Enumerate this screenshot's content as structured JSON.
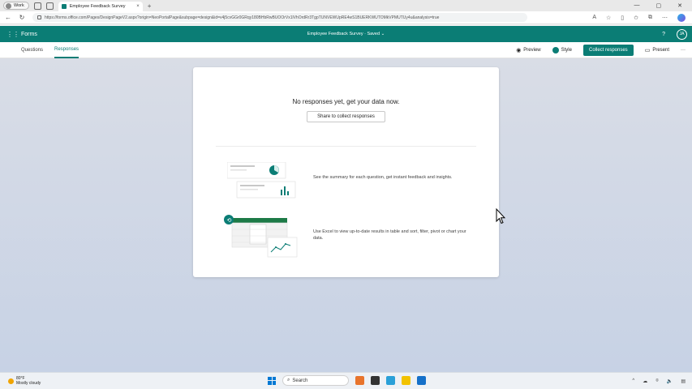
{
  "browser": {
    "profile_label": "Work",
    "tab_title": "Employee Feedback Survey",
    "tab_close": "×",
    "new_tab": "+",
    "url": "https://forms.office.com/Pages/DesignPageV2.aspx?origin=NeoPortalPage&subpage=design&id=v4j5cvGGr0GRqy180BHbRwBUOOrVx1lVhOrdRr3TgpTUNVEWUpRE4wS1BUERKWUTOMkVPMUTUy4u&analysis=true",
    "window_controls": [
      "—",
      "▢",
      "✕"
    ]
  },
  "forms_header": {
    "app_name": "Forms",
    "doc_title": "Employee Feedback Survey · Saved",
    "help_label": "?",
    "avatar_label": "JA"
  },
  "page_tabs": {
    "questions": "Questions",
    "responses": "Responses"
  },
  "toolbar": {
    "preview_label": "Preview",
    "style_label": "Style",
    "collect_label": "Collect responses",
    "present_label": "Present",
    "more_label": "···"
  },
  "card": {
    "heading": "No responses yet, get your data now.",
    "share_button": "Share to collect responses",
    "feature1": "See the summary for each question, get instant feedback and insights.",
    "feature2": "Use Excel to view up-to-date results in table and sort, filter, pivot or chart your data."
  },
  "taskbar": {
    "weather_temp": "80°F",
    "weather_desc": "Mostly cloudy",
    "search_label": "Search"
  },
  "colors": {
    "brand": "#0b7d75",
    "excel": "#1d7a47"
  }
}
